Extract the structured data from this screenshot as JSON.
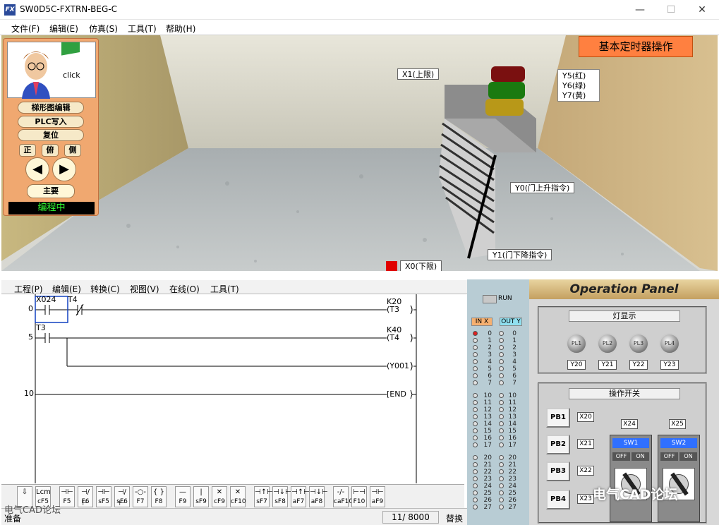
{
  "window": {
    "title": "SW0D5C-FXTRN-BEG-C",
    "icon": "app-icon"
  },
  "menubar": [
    "文件(F)",
    "编辑(E)",
    "仿真(S)",
    "工具(T)",
    "帮助(H)"
  ],
  "control_panel": {
    "click_label": "click",
    "buttons": [
      "梯形图编辑",
      "PLC写入",
      "复位"
    ],
    "views": [
      "正",
      "俯",
      "侧"
    ],
    "nav_prev": "◀",
    "nav_next": "▶",
    "main_button": "主要",
    "status": "编程中"
  },
  "scene": {
    "title_badge": "基本定时器操作",
    "labels": {
      "x1": "X1(上限)",
      "x0": "X0(下限)",
      "y0": "Y0(门上升指令)",
      "y1": "Y1(门下降指令)",
      "y5": "Y5(红)",
      "y6": "Y6(绿)",
      "y7": "Y7(黄)"
    }
  },
  "ladder": {
    "menu": [
      "工程(P)",
      "编辑(E)",
      "转换(C)",
      "视图(V)",
      "在线(O)",
      "工具(T)"
    ],
    "steps": [
      "0",
      "5",
      "10"
    ],
    "contacts": [
      "X024",
      "T4",
      "T3"
    ],
    "coils": [
      {
        "const": "K20",
        "name": "(T3"
      },
      {
        "const": "K40",
        "name": "(T4"
      },
      {
        "const": "",
        "name": "(Y001"
      },
      {
        "const": "",
        "name": "[END"
      }
    ]
  },
  "function_keys": [
    {
      "sym": "⊣⊢",
      "label": "F5"
    },
    {
      "sym": "⊣/⊢",
      "label": "F6"
    },
    {
      "sym": "⊣⊢",
      "label": "sF5"
    },
    {
      "sym": "⊣/⊢",
      "label": "sF6"
    },
    {
      "sym": "-○-",
      "label": "F7"
    },
    {
      "sym": "{ }",
      "label": "F8"
    },
    {
      "sym": "—",
      "label": "F9"
    },
    {
      "sym": "|",
      "label": "sF9"
    },
    {
      "sym": "✕",
      "label": "cF9"
    },
    {
      "sym": "✕",
      "label": "cF10"
    },
    {
      "sym": "⊣↑⊢",
      "label": "sF7"
    },
    {
      "sym": "⊣↓⊢",
      "label": "sF8"
    },
    {
      "sym": "⊣↑⊢",
      "label": "aF7"
    },
    {
      "sym": "⊣↓⊢",
      "label": "aF8"
    },
    {
      "sym": "-/-",
      "label": "caF10"
    },
    {
      "sym": "⊢⊣",
      "label": "F10"
    },
    {
      "sym": "⊣⊢",
      "label": "aF9"
    }
  ],
  "first_tools": [
    "",
    "Lcm",
    "cF5"
  ],
  "statusbar": {
    "left": "准备",
    "steps": "11/ 8000",
    "mode": "替换"
  },
  "io_panel": {
    "run": "RUN",
    "in_header": "IN X",
    "out_header": "OUT Y",
    "numbers_1": [
      "0",
      "1",
      "2",
      "3",
      "4",
      "5",
      "6",
      "7"
    ],
    "numbers_2": [
      "10",
      "11",
      "12",
      "13",
      "14",
      "15",
      "16",
      "17"
    ],
    "numbers_3": [
      "20",
      "21",
      "22",
      "23",
      "24",
      "25",
      "26",
      "27"
    ]
  },
  "operation_panel": {
    "title": "Operation Panel",
    "lamp_section": "灯显示",
    "lamps": [
      "PL1",
      "PL2",
      "PL3",
      "PL4"
    ],
    "lamp_labels": [
      "Y20",
      "Y21",
      "Y22",
      "Y23"
    ],
    "switch_section": "操作开关",
    "pb_buttons": [
      "PB1",
      "PB2",
      "PB3",
      "PB4"
    ],
    "pb_labels": [
      "X20",
      "X21",
      "X22",
      "X23"
    ],
    "sw_labels": [
      "X24",
      "X25"
    ],
    "switches": [
      "SW1",
      "SW2"
    ],
    "off": "OFF",
    "on": "ON"
  },
  "watermark": {
    "left": "电气CAD论坛",
    "right": "电气CAD论坛"
  },
  "colors": {
    "status_green": "#33ff33",
    "badge_orange": "#ff8040",
    "panel_tan": "#f0a870",
    "io_blue": "#b8ccd4"
  }
}
